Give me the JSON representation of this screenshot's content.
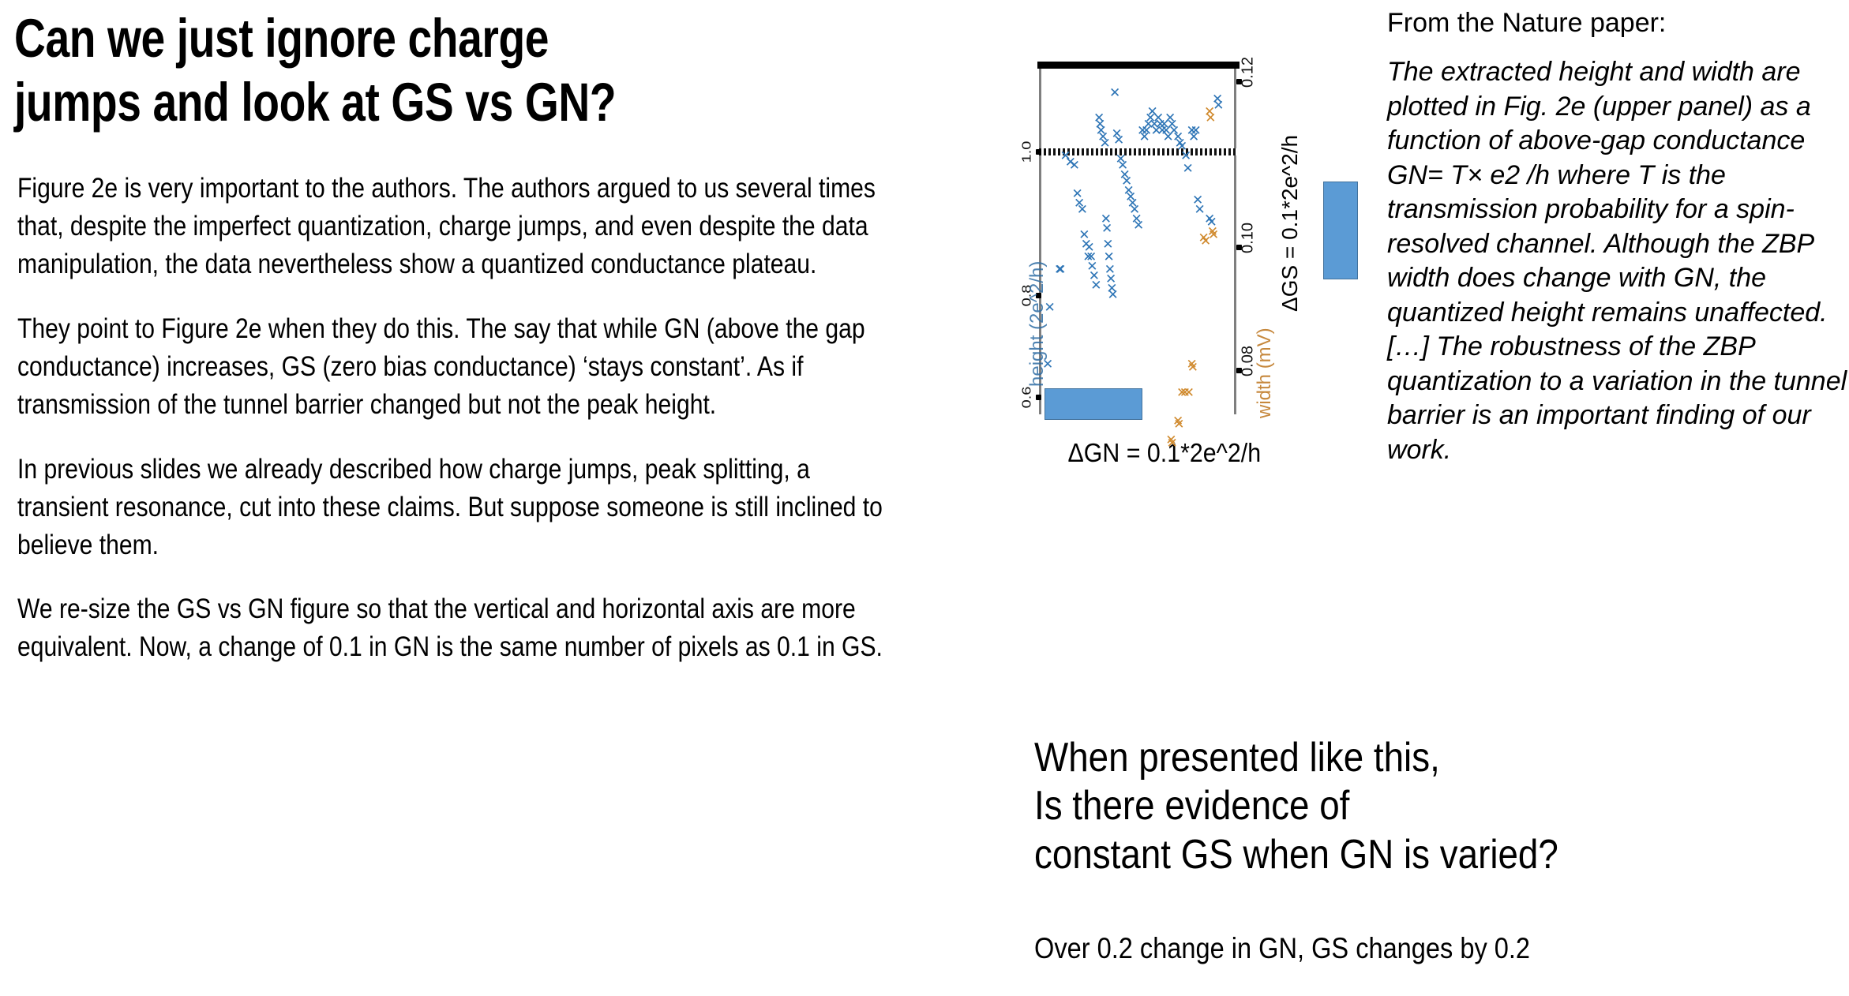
{
  "slide": {
    "title": "Can we just ignore charge\njumps and look at GS vs GN?",
    "paragraphs": [
      "Figure 2e is very important to the authors. The authors argued to us several times that, despite the imperfect quantization, charge jumps, and even despite the data manipulation, the data nevertheless show a quantized conductance plateau.",
      "They point to Figure 2e when they do this. The say that while GN (above the gap conductance) increases, GS (zero bias conductance) ‘stays constant’. As if transmission of the tunnel barrier changed  but not the peak height.",
      "In previous slides we already described how charge jumps, peak splitting, a transient resonance, cut into these claims. But suppose someone is still inclined to believe them.",
      "We re-size the GS vs GN figure so that the vertical and horizontal axis are more equivalent. Now, a change of 0.1 in GN is the same number of pixels as 0.1 in GS."
    ]
  },
  "nature": {
    "heading": "From the Nature paper:",
    "quote": "The extracted height and width are plotted in Fig. 2e (upper panel) as a function of above-gap conductance GN= T× e2 /h where T is the transmission probability for a spin-resolved channel. Although the ZBP width does change with GN, the quantized height remains unaffected. […] The robustness of the ZBP quantization to a variation in the tunnel barrier is an important finding of our work."
  },
  "conclusion": {
    "main": "When presented like this,\nIs there evidence of\nconstant GS when GN is varied?",
    "sub": "Over 0.2 change in GN, GS changes by 0.2"
  },
  "figure": {
    "x_axis_caption": "ΔGN = 0.1*2e^2/h",
    "y_axis_caption": "ΔGS = 0.1*2e^2/h",
    "left_axis_title": "height (2e^2/h)",
    "right_axis_title": "width (mV)",
    "left_ticks": [
      "1.0",
      "0.8",
      "0.6"
    ],
    "right_ticks": [
      "0.12",
      "0.10",
      "0.08"
    ],
    "scale_bar_color": "#5b9bd5",
    "height_marker_color": "#2e75b6",
    "width_marker_color": "#d08a2e",
    "quantized_line_value": "1.0"
  },
  "chart_data": {
    "type": "scatter",
    "title": "",
    "xlabel": "ΔGN = 0.1*2e^2/h",
    "ylabel": "ΔGS = 0.1*2e^2/h",
    "note": "Rotated 90 degrees. Left axis = ZBP height in 2e^2/h (blue X markers); right axis = ZBP width in mV (orange X markers). Horizontal dotted line marks the quantized value 1.0.",
    "xlim": [
      0,
      1
    ],
    "left_ylim": [
      0.55,
      1.1
    ],
    "right_ylim": [
      0.07,
      0.125
    ],
    "grid": false,
    "legend": "none",
    "series": [
      {
        "name": "ZBP height (2e^2/h)",
        "color": "#2e75b6",
        "marker": "x",
        "points": [
          [
            0.04,
            0.63
          ],
          [
            0.05,
            0.72
          ],
          [
            0.1,
            0.78
          ],
          [
            0.105,
            0.78
          ],
          [
            0.13,
            0.96
          ],
          [
            0.155,
            0.95
          ],
          [
            0.175,
            0.945
          ],
          [
            0.19,
            0.9
          ],
          [
            0.2,
            0.885
          ],
          [
            0.215,
            0.875
          ],
          [
            0.225,
            0.835
          ],
          [
            0.235,
            0.82
          ],
          [
            0.245,
            0.8
          ],
          [
            0.25,
            0.815
          ],
          [
            0.26,
            0.8
          ],
          [
            0.265,
            0.785
          ],
          [
            0.275,
            0.77
          ],
          [
            0.285,
            0.755
          ],
          [
            0.3,
            1.02
          ],
          [
            0.305,
            1.01
          ],
          [
            0.31,
            1.0
          ],
          [
            0.32,
            0.99
          ],
          [
            0.33,
            0.98
          ],
          [
            0.335,
            0.86
          ],
          [
            0.34,
            0.845
          ],
          [
            0.345,
            0.82
          ],
          [
            0.35,
            0.8
          ],
          [
            0.355,
            0.78
          ],
          [
            0.36,
            0.765
          ],
          [
            0.365,
            0.75
          ],
          [
            0.37,
            0.74
          ],
          [
            0.38,
            1.06
          ],
          [
            0.39,
            0.995
          ],
          [
            0.4,
            0.985
          ],
          [
            0.41,
            0.955
          ],
          [
            0.42,
            0.945
          ],
          [
            0.43,
            0.93
          ],
          [
            0.44,
            0.92
          ],
          [
            0.45,
            0.905
          ],
          [
            0.46,
            0.895
          ],
          [
            0.47,
            0.885
          ],
          [
            0.48,
            0.875
          ],
          [
            0.49,
            0.86
          ],
          [
            0.5,
            0.85
          ],
          [
            0.52,
            1.0
          ],
          [
            0.53,
            0.99
          ],
          [
            0.54,
            1.0
          ],
          [
            0.55,
            1.01
          ],
          [
            0.56,
            1.02
          ],
          [
            0.57,
            1.03
          ],
          [
            0.58,
            1.01
          ],
          [
            0.59,
            1.0
          ],
          [
            0.6,
            1.02
          ],
          [
            0.61,
            1.01
          ],
          [
            0.62,
            1.0
          ],
          [
            0.63,
            1.01
          ],
          [
            0.64,
            1.0
          ],
          [
            0.65,
            0.99
          ],
          [
            0.66,
            1.02
          ],
          [
            0.67,
            1.01
          ],
          [
            0.68,
            1.0
          ],
          [
            0.7,
            0.99
          ],
          [
            0.71,
            0.98
          ],
          [
            0.72,
            0.975
          ],
          [
            0.74,
            0.96
          ],
          [
            0.75,
            0.94
          ],
          [
            0.77,
            1.0
          ],
          [
            0.78,
            0.99
          ],
          [
            0.79,
            1.0
          ],
          [
            0.8,
            0.89
          ],
          [
            0.81,
            0.875
          ],
          [
            0.86,
            0.86
          ],
          [
            0.87,
            0.855
          ],
          [
            0.9,
            1.05
          ],
          [
            0.905,
            1.04
          ]
        ]
      },
      {
        "name": "ZBP width (mV)",
        "color": "#d08a2e",
        "marker": "x",
        "points": [
          [
            0.86,
            0.118
          ],
          [
            0.865,
            0.117
          ],
          [
            0.83,
            0.098
          ],
          [
            0.84,
            0.0975
          ],
          [
            0.875,
            0.099
          ],
          [
            0.88,
            0.0985
          ],
          [
            0.77,
            0.078
          ],
          [
            0.775,
            0.0775
          ],
          [
            0.72,
            0.0735
          ],
          [
            0.735,
            0.0735
          ],
          [
            0.755,
            0.0735
          ],
          [
            0.7,
            0.069
          ],
          [
            0.705,
            0.0685
          ],
          [
            0.665,
            0.066
          ],
          [
            0.67,
            0.0655
          ]
        ]
      }
    ]
  }
}
